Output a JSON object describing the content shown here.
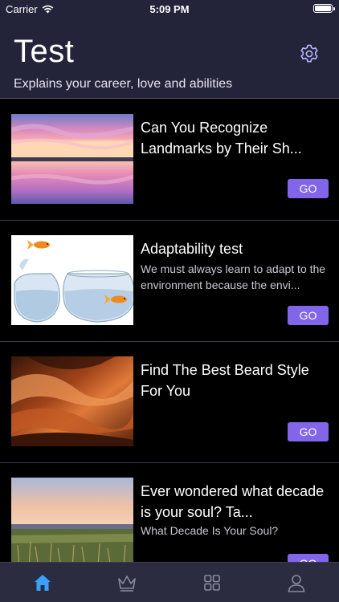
{
  "status_bar": {
    "carrier": "Carrier",
    "time": "5:09 PM"
  },
  "header": {
    "title": "Test",
    "subtitle": "Explains your career, love and abilities",
    "settings_icon": "gear-icon"
  },
  "cards": [
    {
      "title": "Can You Recognize Landmarks by Their Sh...",
      "description": "",
      "button": "GO",
      "image": "sunset-lake-reflection"
    },
    {
      "title": "Adaptability test",
      "description": "We must always learn to adapt to the environment because the envi...",
      "button": "GO",
      "image": "goldfish-jumping-between-bowls"
    },
    {
      "title": "Find The Best Beard Style For You",
      "description": "",
      "button": "GO",
      "image": "red-sandstone-canyon"
    },
    {
      "title": "Ever wondered what decade is your soul? Ta...",
      "description": "What Decade Is Your Soul?",
      "button": "GO",
      "image": "field-at-dusk"
    }
  ],
  "tab_bar": {
    "tabs": [
      {
        "icon": "home-icon",
        "active": true
      },
      {
        "icon": "crown-icon",
        "active": false
      },
      {
        "icon": "grid-icon",
        "active": false
      },
      {
        "icon": "profile-icon",
        "active": false
      }
    ],
    "active_color": "#3aa0ff",
    "inactive_color": "#8a8aa0"
  },
  "colors": {
    "header_bg": "#23233a",
    "accent": "#8266ea",
    "background": "#000000"
  }
}
